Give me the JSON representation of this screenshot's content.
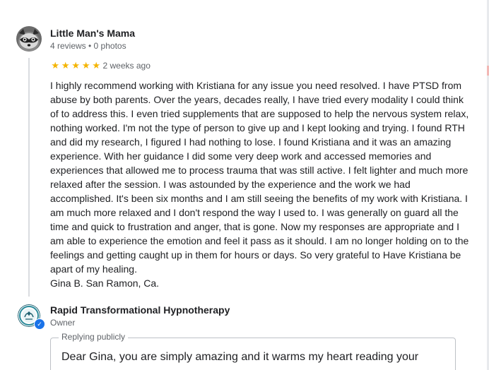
{
  "review": {
    "reviewer_name": "Little Man's Mama",
    "reviewer_meta": "4 reviews • 0 photos",
    "rating": 5,
    "stars": [
      "★",
      "★",
      "★",
      "★",
      "★"
    ],
    "date": "2 weeks ago",
    "text": "I highly recommend working with Kristiana for any issue you need resolved. I have PTSD from abuse by both parents. Over the years, decades really, I have tried every modality I could think of to address this. I even tried supplements that are supposed to help the nervous system relax, nothing worked. I'm not the type of person to give up and I kept looking and trying. I found RTH and did my research, I figured I had nothing to lose. I found Kristiana and it was an amazing experience. With her guidance I did some very deep work and accessed memories and experiences that allowed me to process trauma that was still active. I felt lighter and much more relaxed after the session. I was astounded by the experience and the work we had accomplished. It's been six months and I am still seeing the benefits of my work with Kristiana. I am much more relaxed and I don't respond the way I used to. I was generally on guard all the time and quick to frustration and anger, that is gone. Now my responses are appropriate and I am able to experience the emotion and feel it pass as it should. I am no longer holding on to the feelings and getting caught up in them for hours or days. So very grateful to Have Kristiana be apart of my healing.",
    "signature": "Gina B. San Ramon, Ca."
  },
  "owner_reply": {
    "owner_name": "Rapid Transformational Hypnotherapy",
    "owner_role": "Owner",
    "verified_mark": "✓",
    "box_label": "Replying publicly",
    "reply_text": "Dear Gina, you are simply amazing and it warms my heart reading your"
  },
  "colors": {
    "star": "#f4b400",
    "verified": "#1a73e8",
    "secondary_text": "#5f6368"
  },
  "icons": {
    "reviewer_avatar": "raccoon-avatar-icon",
    "owner_avatar": "rth-logo-icon",
    "verified": "verified-check-icon",
    "star": "star-icon"
  }
}
